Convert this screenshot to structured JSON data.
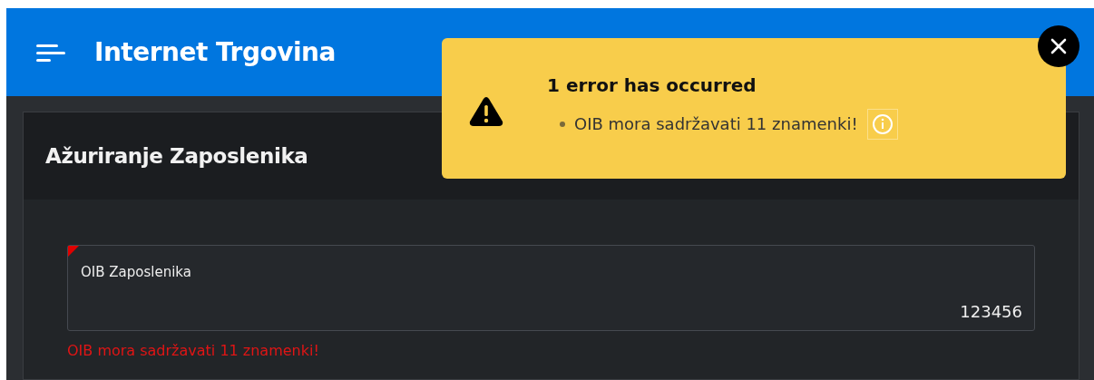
{
  "app_bar": {
    "title": "Internet Trgovina"
  },
  "card": {
    "title": "Ažuriranje Zaposlenika"
  },
  "field": {
    "label": "OIB Zaposlenika",
    "value": "123456",
    "invalid": true,
    "error": "OIB mora sadržavati 11 znamenki!"
  },
  "toast": {
    "title": "1 error has occurred",
    "messages": [
      "OIB mora sadržavati 11 znamenki!"
    ]
  }
}
